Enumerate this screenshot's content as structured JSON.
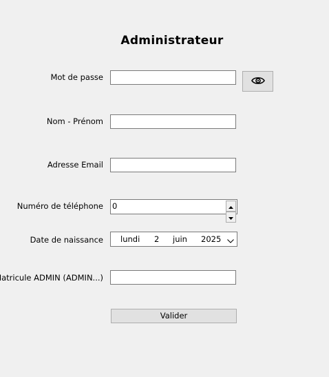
{
  "title": "Administrateur",
  "labels": {
    "password": "Mot de passe",
    "name": "Nom - Prénom",
    "email": "Adresse Email",
    "phone": "Numéro de téléphone",
    "birthdate": "Date de naissance",
    "matricule": "Matricule ADMIN (ADMIN...)"
  },
  "fields": {
    "password": "",
    "name": "",
    "email": "",
    "matricule": ""
  },
  "phone": {
    "value": "0"
  },
  "birthdate": {
    "weekday": "lundi",
    "day": "2",
    "month": "juin",
    "year": "2025"
  },
  "icons": {
    "toggle_password": "eye-icon",
    "spin_up": "spin-up-icon",
    "spin_down": "spin-down-icon",
    "date_dropdown": "chevron-down-icon"
  },
  "buttons": {
    "submit": "Valider"
  }
}
